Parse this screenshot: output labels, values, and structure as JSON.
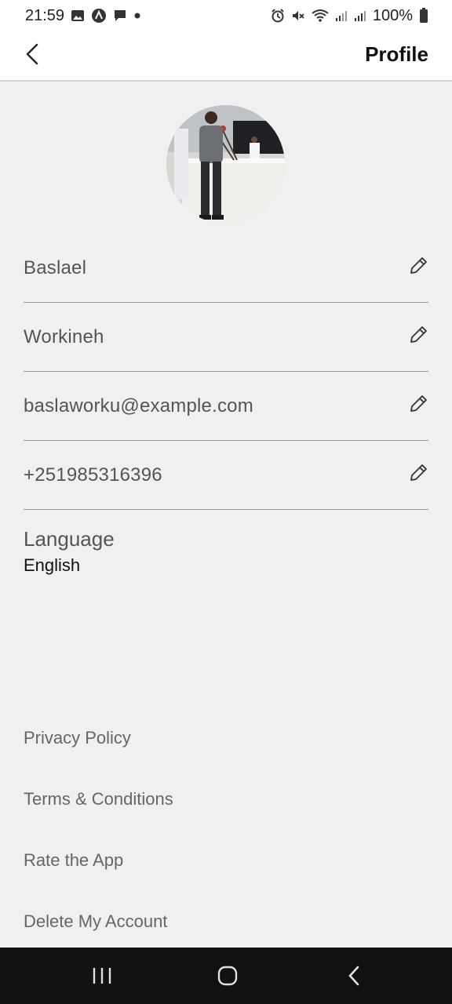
{
  "status_bar": {
    "time": "21:59",
    "battery": "100%",
    "left_icons": [
      "image-icon",
      "app-icon",
      "message-icon",
      "dot-icon"
    ],
    "right_icons": [
      "alarm-icon",
      "mute-icon",
      "wifi-icon",
      "signal-icon",
      "signal-icon",
      "battery-icon"
    ]
  },
  "header": {
    "title": "Profile",
    "back_icon": "chevron-left-icon"
  },
  "profile": {
    "avatar": "profile-photo",
    "fields": [
      {
        "name": "first-name",
        "value": "Baslael"
      },
      {
        "name": "last-name",
        "value": "Workineh"
      },
      {
        "name": "email",
        "value": "baslaworku@example.com"
      },
      {
        "name": "phone",
        "value": "+251985316396"
      }
    ],
    "language_label": "Language",
    "language_value": "English"
  },
  "links": {
    "privacy": "Privacy Policy",
    "terms": "Terms & Conditions",
    "rate": "Rate the App",
    "delete": "Delete My Account"
  },
  "nav": {
    "icons": [
      "recent-apps-icon",
      "home-icon",
      "back-icon"
    ],
    "background": "#111111"
  }
}
